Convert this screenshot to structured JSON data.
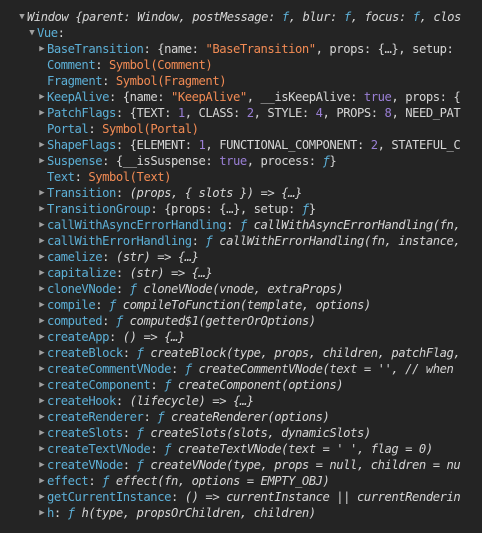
{
  "rows": [
    {
      "indent": 0,
      "toggle": "open",
      "parts": [
        {
          "t": "Window ",
          "c": "k-ital"
        },
        {
          "t": "{parent: Window, postMessage: ",
          "c": "k-ital"
        },
        {
          "t": "f",
          "c": "k-fn"
        },
        {
          "t": ", blur: ",
          "c": "k-ital"
        },
        {
          "t": "f",
          "c": "k-fn"
        },
        {
          "t": ", focus: ",
          "c": "k-ital"
        },
        {
          "t": "f",
          "c": "k-fn"
        },
        {
          "t": ", clos",
          "c": "k-ital"
        }
      ]
    },
    {
      "indent": 1,
      "toggle": "open",
      "parts": [
        {
          "t": "Vue",
          "c": "k-key"
        },
        {
          "t": ":",
          "c": "k-punct"
        }
      ]
    },
    {
      "indent": 2,
      "toggle": "closed",
      "parts": [
        {
          "t": "BaseTransition",
          "c": "k-key"
        },
        {
          "t": ": {name: ",
          "c": "k-plain"
        },
        {
          "t": "\"BaseTransition\"",
          "c": "k-str"
        },
        {
          "t": ", props: {…}, setup: ",
          "c": "k-plain"
        }
      ]
    },
    {
      "indent": 2,
      "toggle": "none",
      "parts": [
        {
          "t": "Comment",
          "c": "k-key"
        },
        {
          "t": ": ",
          "c": "k-plain"
        },
        {
          "t": "Symbol(Comment)",
          "c": "k-sym"
        }
      ]
    },
    {
      "indent": 2,
      "toggle": "none",
      "parts": [
        {
          "t": "Fragment",
          "c": "k-key"
        },
        {
          "t": ": ",
          "c": "k-plain"
        },
        {
          "t": "Symbol(Fragment)",
          "c": "k-sym"
        }
      ]
    },
    {
      "indent": 2,
      "toggle": "closed",
      "parts": [
        {
          "t": "KeepAlive",
          "c": "k-key"
        },
        {
          "t": ": {name: ",
          "c": "k-plain"
        },
        {
          "t": "\"KeepAlive\"",
          "c": "k-str"
        },
        {
          "t": ", __isKeepAlive: ",
          "c": "k-plain"
        },
        {
          "t": "true",
          "c": "k-num"
        },
        {
          "t": ", props: {",
          "c": "k-plain"
        }
      ]
    },
    {
      "indent": 2,
      "toggle": "closed",
      "parts": [
        {
          "t": "PatchFlags",
          "c": "k-key"
        },
        {
          "t": ": {TEXT: ",
          "c": "k-plain"
        },
        {
          "t": "1",
          "c": "k-num"
        },
        {
          "t": ", CLASS: ",
          "c": "k-plain"
        },
        {
          "t": "2",
          "c": "k-num"
        },
        {
          "t": ", STYLE: ",
          "c": "k-plain"
        },
        {
          "t": "4",
          "c": "k-num"
        },
        {
          "t": ", PROPS: ",
          "c": "k-plain"
        },
        {
          "t": "8",
          "c": "k-num"
        },
        {
          "t": ", NEED_PAT",
          "c": "k-plain"
        }
      ]
    },
    {
      "indent": 2,
      "toggle": "none",
      "parts": [
        {
          "t": "Portal",
          "c": "k-key"
        },
        {
          "t": ": ",
          "c": "k-plain"
        },
        {
          "t": "Symbol(Portal)",
          "c": "k-sym"
        }
      ]
    },
    {
      "indent": 2,
      "toggle": "closed",
      "parts": [
        {
          "t": "ShapeFlags",
          "c": "k-key"
        },
        {
          "t": ": {ELEMENT: ",
          "c": "k-plain"
        },
        {
          "t": "1",
          "c": "k-num"
        },
        {
          "t": ", FUNCTIONAL_COMPONENT: ",
          "c": "k-plain"
        },
        {
          "t": "2",
          "c": "k-num"
        },
        {
          "t": ", STATEFUL_C",
          "c": "k-plain"
        }
      ]
    },
    {
      "indent": 2,
      "toggle": "closed",
      "parts": [
        {
          "t": "Suspense",
          "c": "k-key"
        },
        {
          "t": ": {__isSuspense: ",
          "c": "k-plain"
        },
        {
          "t": "true",
          "c": "k-num"
        },
        {
          "t": ", process: ",
          "c": "k-plain"
        },
        {
          "t": "ƒ",
          "c": "k-fn"
        },
        {
          "t": "}",
          "c": "k-plain"
        }
      ]
    },
    {
      "indent": 2,
      "toggle": "none",
      "parts": [
        {
          "t": "Text",
          "c": "k-key"
        },
        {
          "t": ": ",
          "c": "k-plain"
        },
        {
          "t": "Symbol(Text)",
          "c": "k-sym"
        }
      ]
    },
    {
      "indent": 2,
      "toggle": "closed",
      "parts": [
        {
          "t": "Transition",
          "c": "k-key"
        },
        {
          "t": ": ",
          "c": "k-plain"
        },
        {
          "t": "(props, { slots }) => {…}",
          "c": "k-ital"
        }
      ]
    },
    {
      "indent": 2,
      "toggle": "closed",
      "parts": [
        {
          "t": "TransitionGroup",
          "c": "k-key"
        },
        {
          "t": ": {props: {…}, setup: ",
          "c": "k-plain"
        },
        {
          "t": "ƒ",
          "c": "k-fn"
        },
        {
          "t": "}",
          "c": "k-plain"
        }
      ]
    },
    {
      "indent": 2,
      "toggle": "closed",
      "parts": [
        {
          "t": "callWithAsyncErrorHandling",
          "c": "k-key"
        },
        {
          "t": ": ",
          "c": "k-plain"
        },
        {
          "t": "ƒ",
          "c": "k-fn"
        },
        {
          "t": " callWithAsyncErrorHandling(fn,",
          "c": "k-ital"
        }
      ]
    },
    {
      "indent": 2,
      "toggle": "closed",
      "parts": [
        {
          "t": "callWithErrorHandling",
          "c": "k-key"
        },
        {
          "t": ": ",
          "c": "k-plain"
        },
        {
          "t": "ƒ",
          "c": "k-fn"
        },
        {
          "t": " callWithErrorHandling(fn, instance,",
          "c": "k-ital"
        }
      ]
    },
    {
      "indent": 2,
      "toggle": "closed",
      "parts": [
        {
          "t": "camelize",
          "c": "k-key"
        },
        {
          "t": ": ",
          "c": "k-plain"
        },
        {
          "t": "(str) => {…}",
          "c": "k-ital"
        }
      ]
    },
    {
      "indent": 2,
      "toggle": "closed",
      "parts": [
        {
          "t": "capitalize",
          "c": "k-key"
        },
        {
          "t": ": ",
          "c": "k-plain"
        },
        {
          "t": "(str) => {…}",
          "c": "k-ital"
        }
      ]
    },
    {
      "indent": 2,
      "toggle": "closed",
      "parts": [
        {
          "t": "cloneVNode",
          "c": "k-key"
        },
        {
          "t": ": ",
          "c": "k-plain"
        },
        {
          "t": "ƒ",
          "c": "k-fn"
        },
        {
          "t": " cloneVNode(vnode, extraProps)",
          "c": "k-ital"
        }
      ]
    },
    {
      "indent": 2,
      "toggle": "closed",
      "parts": [
        {
          "t": "compile",
          "c": "k-key"
        },
        {
          "t": ": ",
          "c": "k-plain"
        },
        {
          "t": "ƒ",
          "c": "k-fn"
        },
        {
          "t": " compileToFunction(template, options)",
          "c": "k-ital"
        }
      ]
    },
    {
      "indent": 2,
      "toggle": "closed",
      "parts": [
        {
          "t": "computed",
          "c": "k-key"
        },
        {
          "t": ": ",
          "c": "k-plain"
        },
        {
          "t": "ƒ",
          "c": "k-fn"
        },
        {
          "t": " computed$1(getterOrOptions)",
          "c": "k-ital"
        }
      ]
    },
    {
      "indent": 2,
      "toggle": "closed",
      "parts": [
        {
          "t": "createApp",
          "c": "k-key"
        },
        {
          "t": ": ",
          "c": "k-plain"
        },
        {
          "t": "() => {…}",
          "c": "k-ital"
        }
      ]
    },
    {
      "indent": 2,
      "toggle": "closed",
      "parts": [
        {
          "t": "createBlock",
          "c": "k-key"
        },
        {
          "t": ": ",
          "c": "k-plain"
        },
        {
          "t": "ƒ",
          "c": "k-fn"
        },
        {
          "t": " createBlock(type, props, children, patchFlag,",
          "c": "k-ital"
        }
      ]
    },
    {
      "indent": 2,
      "toggle": "closed",
      "parts": [
        {
          "t": "createCommentVNode",
          "c": "k-key"
        },
        {
          "t": ": ",
          "c": "k-plain"
        },
        {
          "t": "ƒ",
          "c": "k-fn"
        },
        {
          "t": " createCommentVNode(text = '', // when",
          "c": "k-ital"
        }
      ]
    },
    {
      "indent": 2,
      "toggle": "closed",
      "parts": [
        {
          "t": "createComponent",
          "c": "k-key"
        },
        {
          "t": ": ",
          "c": "k-plain"
        },
        {
          "t": "ƒ",
          "c": "k-fn"
        },
        {
          "t": " createComponent(options)",
          "c": "k-ital"
        }
      ]
    },
    {
      "indent": 2,
      "toggle": "closed",
      "parts": [
        {
          "t": "createHook",
          "c": "k-key"
        },
        {
          "t": ": ",
          "c": "k-plain"
        },
        {
          "t": "(lifecycle) => {…}",
          "c": "k-ital"
        }
      ]
    },
    {
      "indent": 2,
      "toggle": "closed",
      "parts": [
        {
          "t": "createRenderer",
          "c": "k-key"
        },
        {
          "t": ": ",
          "c": "k-plain"
        },
        {
          "t": "ƒ",
          "c": "k-fn"
        },
        {
          "t": " createRenderer(options)",
          "c": "k-ital"
        }
      ]
    },
    {
      "indent": 2,
      "toggle": "closed",
      "parts": [
        {
          "t": "createSlots",
          "c": "k-key"
        },
        {
          "t": ": ",
          "c": "k-plain"
        },
        {
          "t": "ƒ",
          "c": "k-fn"
        },
        {
          "t": " createSlots(slots, dynamicSlots)",
          "c": "k-ital"
        }
      ]
    },
    {
      "indent": 2,
      "toggle": "closed",
      "parts": [
        {
          "t": "createTextVNode",
          "c": "k-key"
        },
        {
          "t": ": ",
          "c": "k-plain"
        },
        {
          "t": "ƒ",
          "c": "k-fn"
        },
        {
          "t": " createTextVNode(text = ' ', flag = 0)",
          "c": "k-ital"
        }
      ]
    },
    {
      "indent": 2,
      "toggle": "closed",
      "parts": [
        {
          "t": "createVNode",
          "c": "k-key"
        },
        {
          "t": ": ",
          "c": "k-plain"
        },
        {
          "t": "ƒ",
          "c": "k-fn"
        },
        {
          "t": " createVNode(type, props = null, children = nu",
          "c": "k-ital"
        }
      ]
    },
    {
      "indent": 2,
      "toggle": "closed",
      "parts": [
        {
          "t": "effect",
          "c": "k-key"
        },
        {
          "t": ": ",
          "c": "k-plain"
        },
        {
          "t": "ƒ",
          "c": "k-fn"
        },
        {
          "t": " effect(fn, options = EMPTY_OBJ)",
          "c": "k-ital"
        }
      ]
    },
    {
      "indent": 2,
      "toggle": "closed",
      "parts": [
        {
          "t": "getCurrentInstance",
          "c": "k-key"
        },
        {
          "t": ": ",
          "c": "k-plain"
        },
        {
          "t": "() => currentInstance || currentRenderin",
          "c": "k-ital"
        }
      ]
    },
    {
      "indent": 2,
      "toggle": "closed",
      "parts": [
        {
          "t": "h",
          "c": "k-key"
        },
        {
          "t": ": ",
          "c": "k-plain"
        },
        {
          "t": "ƒ",
          "c": "k-fn"
        },
        {
          "t": " h(type, propsOrChildren, children)",
          "c": "k-ital"
        }
      ]
    }
  ],
  "toggles": {
    "open": "▼",
    "closed": "▶",
    "none": ""
  }
}
